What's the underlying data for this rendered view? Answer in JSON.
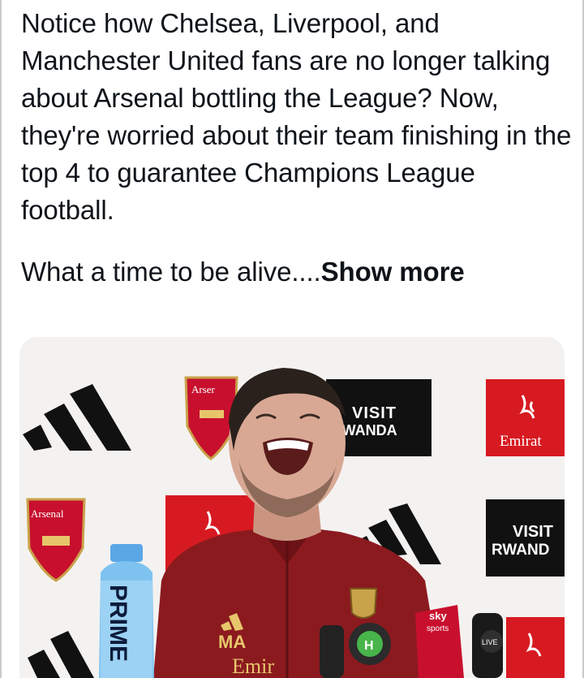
{
  "post": {
    "paragraph1": "Notice how Chelsea, Liverpool, and Manchester United fans are no longer talking about Arsenal bottling the League? Now, they're worried about their team finishing in the top 4 to guarantee Champions League football.",
    "paragraph2": "What a time to be alive....",
    "show_more": "Show more"
  },
  "image": {
    "backdrop_text": {
      "visit_rwanda_1": "VISIT",
      "visit_rwanda_2": "RWANDA",
      "visit_rwanda_3": "VISIT",
      "visit_rwanda_4": "RWAND",
      "emirates_1": "Emirat",
      "emirates_2": "Em",
      "arsenal_crest_1": "Arsenal",
      "arsenal_crest_2": "Arser",
      "prime_bottle": "PRIME",
      "jacket_initials": "MA",
      "jacket_sponsor": "Emir",
      "mic_sky": "sky",
      "mic_sports": "sports",
      "mic_live": "LIVE"
    },
    "colors": {
      "arsenal_red": "#c8102e",
      "emirates_red": "#d71a21",
      "rwanda_black": "#111111",
      "jacket": "#8b1a1f"
    }
  }
}
